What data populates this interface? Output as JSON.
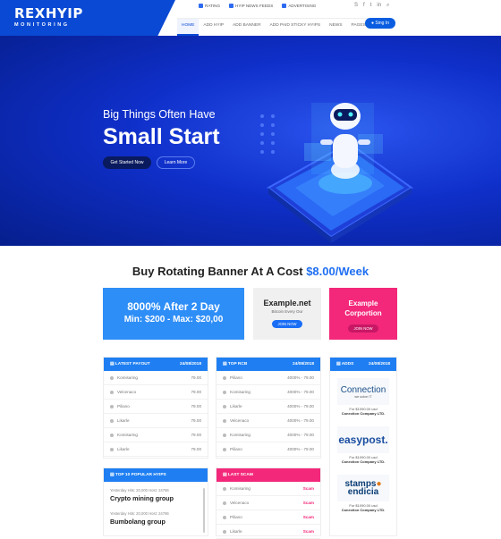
{
  "header": {
    "logo_title": "REXHYIP",
    "logo_subtitle": "MONITORING",
    "top_links": [
      "RATING",
      "HYIP NEWS FEEDS",
      "ADVERTISING"
    ],
    "social_icons": [
      "skype-icon",
      "facebook-icon",
      "twitter-icon",
      "linkedin-icon",
      "search-icon"
    ],
    "nav": [
      "HOME",
      "ADD HYIP",
      "ADD BANNER",
      "ADD PAID STICKY HYIPS",
      "NEWS",
      "PAGES"
    ],
    "signin": "Sing In"
  },
  "hero": {
    "subtitle": "Big Things Often Have",
    "title": "Small Start",
    "btn_primary": "Get Started Now",
    "btn_secondary": "Learn More"
  },
  "banner": {
    "heading": "Buy Rotating Banner At A Cost",
    "price": "$8.00/Week",
    "card1_title": "8000% After 2 Day",
    "card1_sub": "Min: $200 - Max: $20,00",
    "card2_title": "Example.net",
    "card2_sub": "Bitcoin Every Our",
    "card2_btn": "JOIN NOW",
    "card3_title": "Example Corportion",
    "card3_btn": "JOIN NOW"
  },
  "latest_payout": {
    "title": "LATEST PAYOUT",
    "date": "24/08/2018",
    "rows": [
      {
        "name": "Komisaring",
        "value": "79.00"
      },
      {
        "name": "Velcenaco",
        "value": "79.00"
      },
      {
        "name": "Piliano",
        "value": "79.00"
      },
      {
        "name": "Likarle",
        "value": "79.00"
      },
      {
        "name": "Komisaring",
        "value": "79.00"
      },
      {
        "name": "Likarle",
        "value": "79.00"
      }
    ]
  },
  "top_rcb": {
    "title": "TOP RCB",
    "date": "24/08/2018",
    "rows": [
      {
        "name": "Piliano",
        "value": "4000% - 79.00"
      },
      {
        "name": "Komisaring",
        "value": "4000% - 79.00"
      },
      {
        "name": "Likarle",
        "value": "4000% - 79.00"
      },
      {
        "name": "Velcenaco",
        "value": "4000% - 79.00"
      },
      {
        "name": "Komisaring",
        "value": "4000% - 79.00"
      },
      {
        "name": "Piliano",
        "value": "4000% - 79.00"
      }
    ]
  },
  "adds": {
    "title": "ADDS",
    "date": "24/08/2018",
    "items": [
      {
        "brand": "Connection",
        "tag": "we solve IT",
        "price": "For $1090.00 usd",
        "company": "Conection Company LTD."
      },
      {
        "brand": "easypost.",
        "price": "For $1090.00 usd",
        "company": "Conection Company LTD."
      },
      {
        "brand": "stamps",
        "brand2": "endicia",
        "price": "For $1090.00 usd",
        "company": "Conection Company LTD."
      }
    ]
  },
  "popular": {
    "title": "TOP 10 POPULAR HYIPS",
    "items": [
      {
        "meta": "Yesterday Hits: 20,000  Host: 24786",
        "name": "Crypto mining group"
      },
      {
        "meta": "Yesterday Hits: 20,000  Host: 24786",
        "name": "Bumbolang group"
      }
    ]
  },
  "last_scam": {
    "title": "LAST SCAM",
    "rows": [
      {
        "name": "Komisaring",
        "value": "Scam"
      },
      {
        "name": "Velcenaco",
        "value": "Scam"
      },
      {
        "name": "Piliano",
        "value": "Scam"
      },
      {
        "name": "Likarle",
        "value": "Scam"
      }
    ]
  },
  "colors": {
    "primary": "#0a49d3",
    "accent": "#1f7ff2",
    "pink": "#f3287a"
  }
}
